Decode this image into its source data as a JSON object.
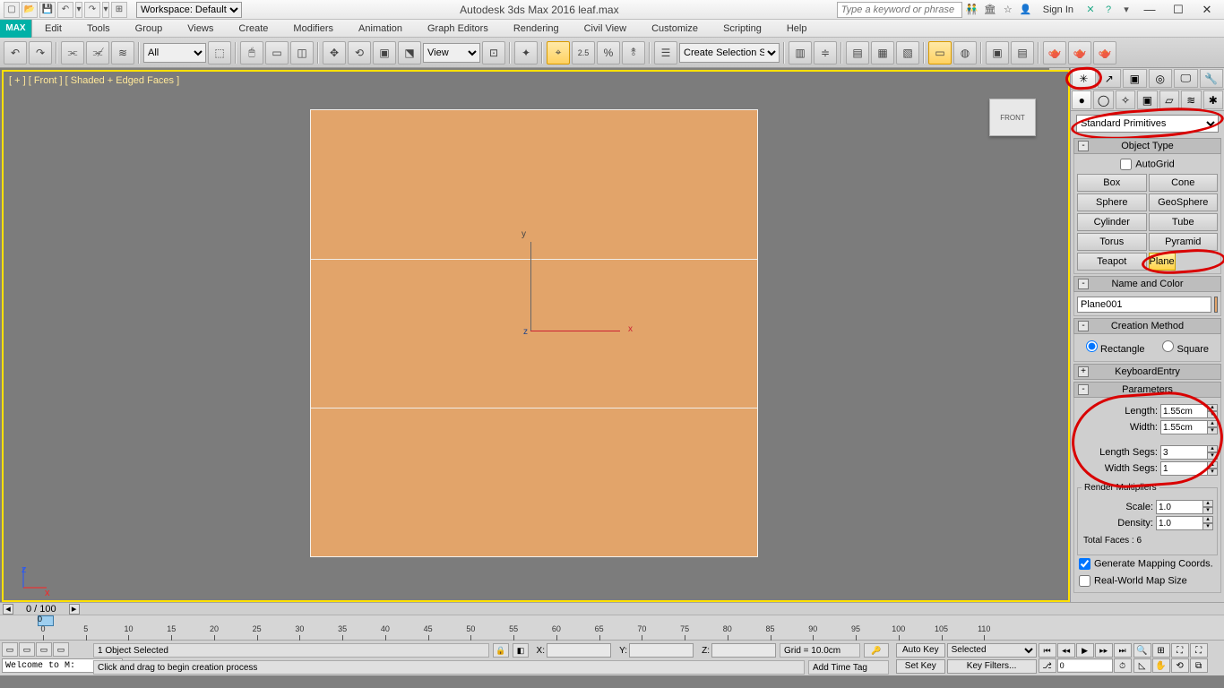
{
  "titlebar": {
    "workspace_label": "Workspace: Default",
    "app_title": "Autodesk 3ds Max 2016    leaf.max",
    "search_placeholder": "Type a keyword or phrase",
    "sign_in": "Sign In"
  },
  "menubar": {
    "logo": "MAX",
    "items": [
      "Edit",
      "Tools",
      "Group",
      "Views",
      "Create",
      "Modifiers",
      "Animation",
      "Graph Editors",
      "Rendering",
      "Civil View",
      "Customize",
      "Scripting",
      "Help"
    ]
  },
  "maintoolbar": {
    "filter": "All",
    "refsys": "View",
    "named_sel": "Create Selection Set"
  },
  "viewport": {
    "label": "[ + ] [ Front ]  [ Shaded + Edged Faces ]",
    "cube": "FRONT",
    "axis_y": "y",
    "axis_x": "x",
    "axis_z": "z"
  },
  "cmd": {
    "category": "Standard Primitives",
    "rollouts": {
      "object_type": "Object Type",
      "autogrid": "AutoGrid",
      "buttons": [
        "Box",
        "Cone",
        "Sphere",
        "GeoSphere",
        "Cylinder",
        "Tube",
        "Torus",
        "Pyramid",
        "Teapot",
        "Plane"
      ],
      "name_color": "Name and Color",
      "object_name": "Plane001",
      "creation_method": "Creation Method",
      "cm_rect": "Rectangle",
      "cm_square": "Square",
      "keyboard_entry": "KeyboardEntry",
      "parameters": "Parameters",
      "length_lbl": "Length:",
      "length_val": "1.55cm",
      "width_lbl": "Width:",
      "width_val": "1.55cm",
      "lsegs_lbl": "Length Segs:",
      "lsegs_val": "3",
      "wsegs_lbl": "Width Segs:",
      "wsegs_val": "1",
      "render_mult": "Render Multipliers",
      "scale_lbl": "Scale:",
      "scale_val": "1.0",
      "density_lbl": "Density:",
      "density_val": "1.0",
      "total_faces": "Total Faces : 6",
      "gen_map": "Generate Mapping Coords.",
      "real_world": "Real-World Map Size"
    }
  },
  "timeline": {
    "frame_counter": "0 / 100",
    "slider_lbl": "0",
    "ticks": [
      0,
      5,
      10,
      15,
      20,
      25,
      30,
      35,
      40,
      45,
      50,
      55,
      60,
      65,
      70,
      75,
      80,
      85,
      90,
      95,
      100,
      105,
      110
    ]
  },
  "status": {
    "welcome": "Welcome to M:",
    "selected": "1 Object Selected",
    "prompt": "Click and drag to begin creation process",
    "coord_x_lbl": "X:",
    "coord_y_lbl": "Y:",
    "coord_z_lbl": "Z:",
    "grid": "Grid = 10.0cm",
    "add_time_tag": "Add Time Tag",
    "auto_key": "Auto Key",
    "set_key": "Set Key",
    "sel_filter": "Selected",
    "key_filters": "Key Filters...",
    "cur_frame": "0"
  }
}
